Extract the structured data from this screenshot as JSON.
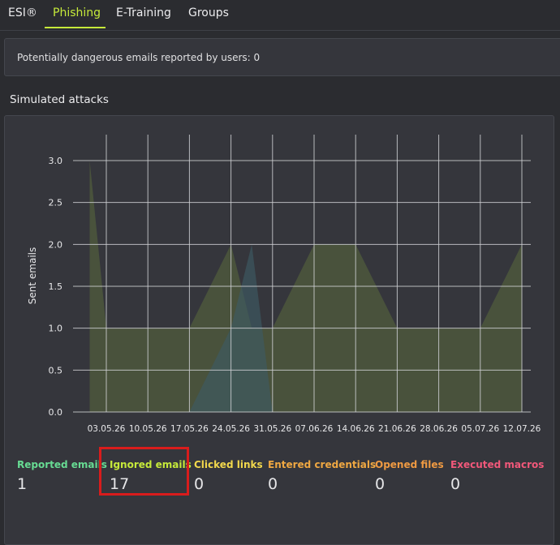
{
  "tabs": [
    {
      "label": "ESI®",
      "active": false
    },
    {
      "label": "Phishing",
      "active": true
    },
    {
      "label": "E-Training",
      "active": false
    },
    {
      "label": "Groups",
      "active": false
    }
  ],
  "accent_color": "#c6ea3a",
  "info": {
    "text": "Potentially dangerous emails reported by users: 0"
  },
  "section_title": "Simulated attacks",
  "chart_data": {
    "type": "area",
    "ylabel": "Sent emails",
    "ylim": [
      0,
      3.0
    ],
    "yticks": [
      "0.0",
      "0.5",
      "1.0",
      "1.5",
      "2.0",
      "2.5",
      "3.0"
    ],
    "categories": [
      "03.05.26",
      "10.05.26",
      "17.05.26",
      "24.05.26",
      "31.05.26",
      "07.06.26",
      "14.06.26",
      "21.06.26",
      "28.06.26",
      "05.07.26",
      "12.07.26"
    ],
    "x_index": [
      -0.4,
      0,
      1,
      2,
      3,
      3.5,
      4,
      5,
      6,
      7,
      8,
      9,
      10
    ],
    "series": [
      {
        "values": [
          3,
          1,
          1,
          1,
          2,
          1,
          1,
          2,
          2,
          1,
          1,
          1,
          2
        ],
        "color": "#5a6a3c"
      },
      {
        "values": [
          0,
          0,
          0,
          0,
          1,
          2,
          0,
          0,
          0,
          0,
          0,
          0,
          0
        ],
        "color": "#3d5a63"
      }
    ],
    "grid": true
  },
  "stats": [
    {
      "label": "Reported emails",
      "value": "1",
      "color": "#67dc93"
    },
    {
      "label": "Ignored emails",
      "value": "17",
      "color": "#c6ea3a"
    },
    {
      "label": "Clicked links",
      "value": "0",
      "color": "#f2d84c"
    },
    {
      "label": "Entered credentials",
      "value": "0",
      "color": "#f0a842"
    },
    {
      "label": "Opened files",
      "value": "0",
      "color": "#ef9a42"
    },
    {
      "label": "Executed macros",
      "value": "0",
      "color": "#f1587a"
    }
  ]
}
